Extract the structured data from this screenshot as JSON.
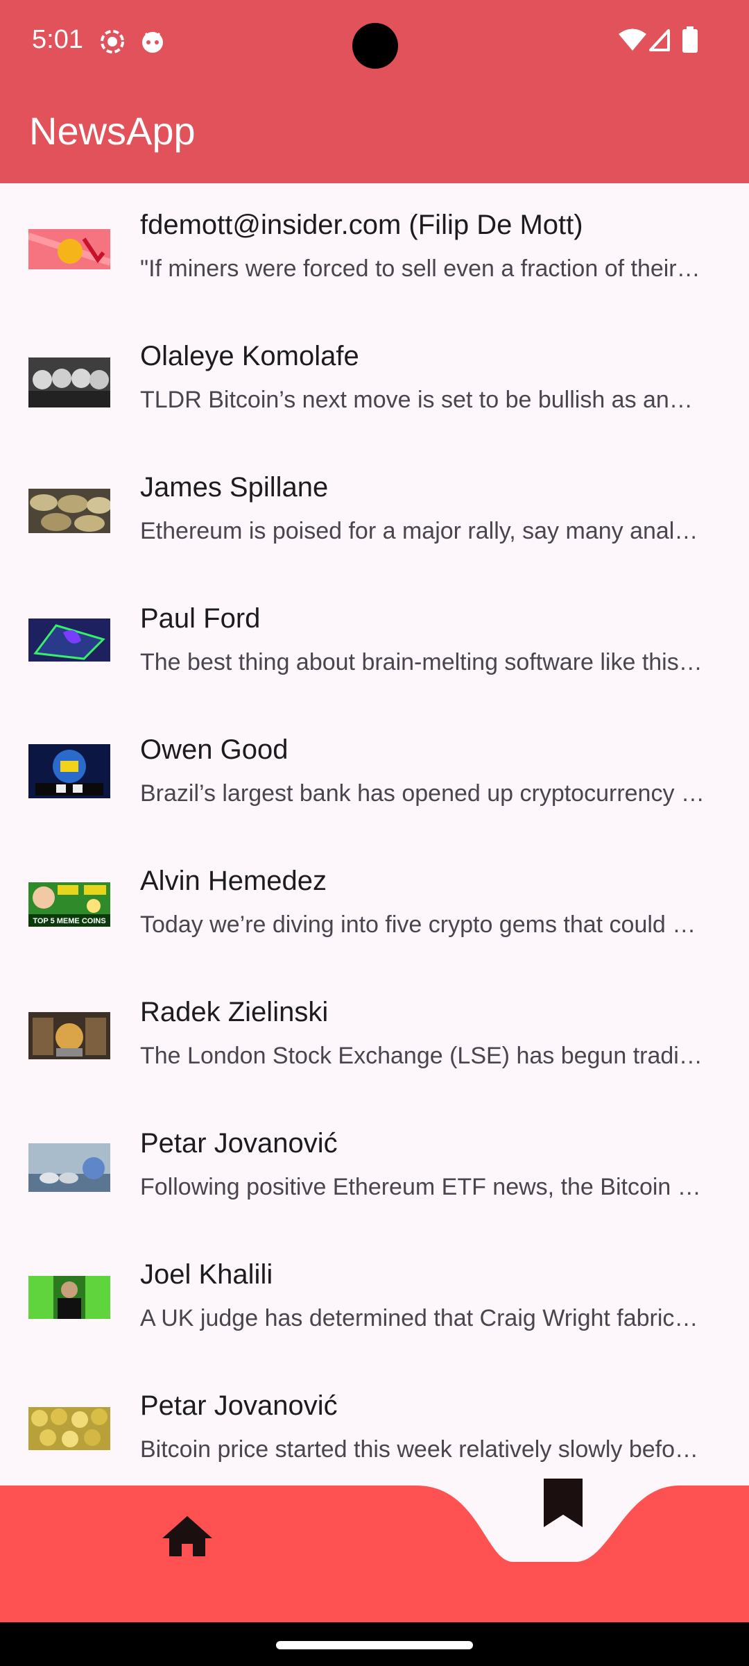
{
  "status": {
    "time": "5:01"
  },
  "app": {
    "title": "NewsApp"
  },
  "articles": [
    {
      "author": "fdemott@insider.com (Filip De Mott)",
      "snippet": "\"If miners were forced to sell even a fraction of their holdings, it would have a material impact on price.\""
    },
    {
      "author": "Olaleye Komolafe",
      "snippet": "TLDR Bitcoin’s next move is set to be bullish as analysts see strength ahead."
    },
    {
      "author": "James Spillane",
      "snippet": "Ethereum is poised for a major rally, say many analysts following the ETF news."
    },
    {
      "author": "Paul Ford",
      "snippet": "The best thing about brain-melting software like this is how much it teaches you."
    },
    {
      "author": "Owen Good",
      "snippet": "Brazil’s largest bank has opened up cryptocurrency trading to its customers."
    },
    {
      "author": "Alvin Hemedez",
      "snippet": "Today we’re diving into five crypto gems that could deliver massive returns."
    },
    {
      "author": "Radek Zielinski",
      "snippet": "The London Stock Exchange (LSE) has begun trading bitcoin and ether ETNs."
    },
    {
      "author": "Petar Jovanović",
      "snippet": "Following positive Ethereum ETF news, the Bitcoin price rallied strongly."
    },
    {
      "author": "Joel Khalili",
      "snippet": "A UK judge has determined that Craig Wright fabricated documents in court."
    },
    {
      "author": "Petar Jovanović",
      "snippet": "Bitcoin price started this week relatively slowly before picking up steam."
    }
  ],
  "thumbnails": [
    {
      "name": "bitcoin-down-chart",
      "bg": "#f2727c"
    },
    {
      "name": "hooded-masks",
      "bg": "#4a4a4a"
    },
    {
      "name": "gold-coins",
      "bg": "#8c7a55"
    },
    {
      "name": "neon-laptop",
      "bg": "#232a6b"
    },
    {
      "name": "brazil-globe",
      "bg": "#0d1a4a"
    },
    {
      "name": "meme-coins",
      "bg": "#2f8a2a"
    },
    {
      "name": "exchange-building",
      "bg": "#6b4d2e"
    },
    {
      "name": "coins-blue",
      "bg": "#9fb3c2"
    },
    {
      "name": "matrix-portrait",
      "bg": "#2b6f1f"
    },
    {
      "name": "coin-pile",
      "bg": "#cbb24a"
    }
  ],
  "colors": {
    "appbar": "#e1525b",
    "bottomnav": "#fe5252",
    "background": "#fdf7fb"
  },
  "nav": {
    "home_icon": "home-icon",
    "bookmark_icon": "bookmark-icon"
  }
}
